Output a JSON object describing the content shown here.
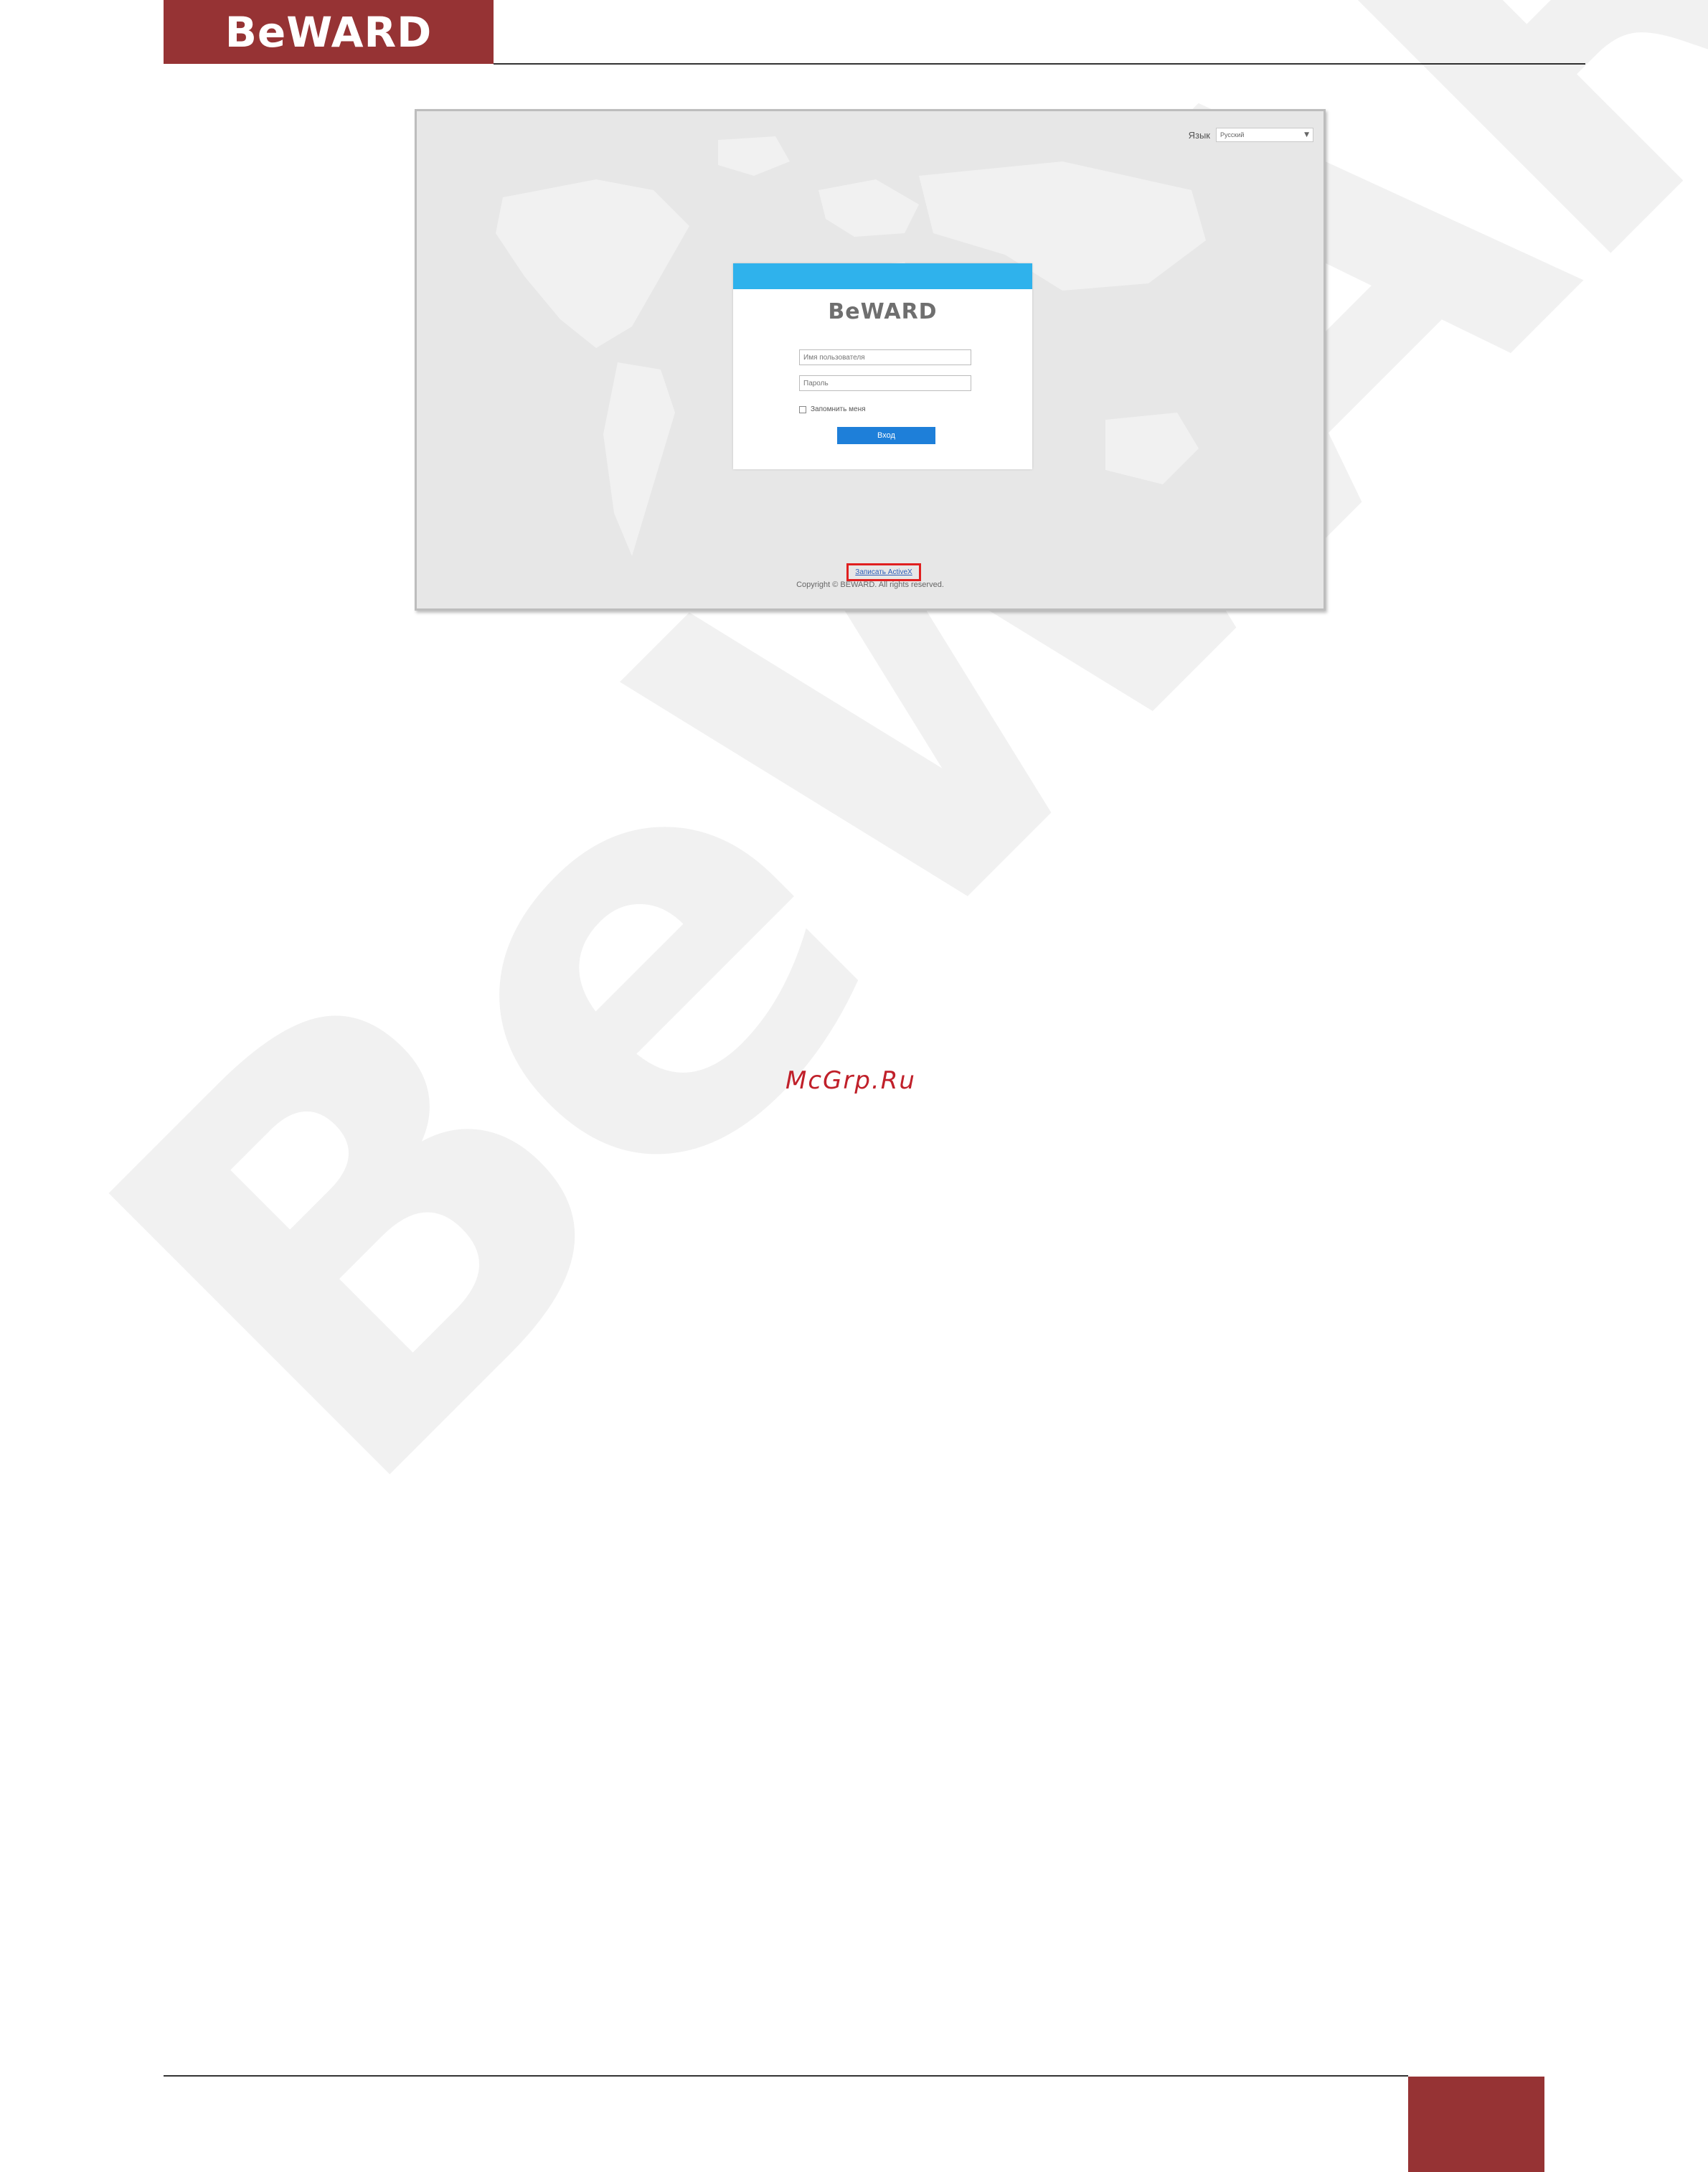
{
  "header": {
    "logo_text": "BeWARD",
    "brand_color": "#963334"
  },
  "watermark": {
    "text": "BeWARD"
  },
  "screenshot": {
    "lang_label": "Язык",
    "lang_selected": "Русский",
    "card": {
      "logo_text": "BeWARD",
      "username_placeholder": "Имя пользователя",
      "password_placeholder": "Пароль",
      "remember_label": "Запомнить меня",
      "login_button": "Вход",
      "accent_color": "#2fb2ec",
      "button_color": "#1e7fd9"
    },
    "footer_link": "Записать ActiveX",
    "copyright": "Copyright © BEWARD. All rights reserved."
  },
  "site_watermark": "McGrp.Ru"
}
